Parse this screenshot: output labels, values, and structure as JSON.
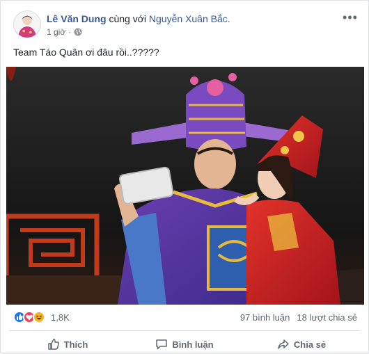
{
  "post": {
    "author": "Lê Văn Dung",
    "with_text": "cùng với",
    "tagged": "Nguyễn Xuân Bắc.",
    "time": "1 giờ",
    "privacy_icon": "globe-icon",
    "more_icon": "more-options-icon",
    "caption": "Team Táo Quân ơi đâu rồi..?????"
  },
  "stats": {
    "reaction_icons": [
      "like-icon",
      "love-icon",
      "haha-icon"
    ],
    "reaction_count": "1,8K",
    "comments": "97 bình luận",
    "shares": "18 lượt chia sẻ"
  },
  "actions": {
    "like_label": "Thích",
    "comment_label": "Bình luận",
    "share_label": "Chia sẻ"
  },
  "colors": {
    "link": "#365899",
    "like": "#1877f2",
    "love": "#f33e58",
    "haha": "#f7b125",
    "muted": "#606770"
  }
}
